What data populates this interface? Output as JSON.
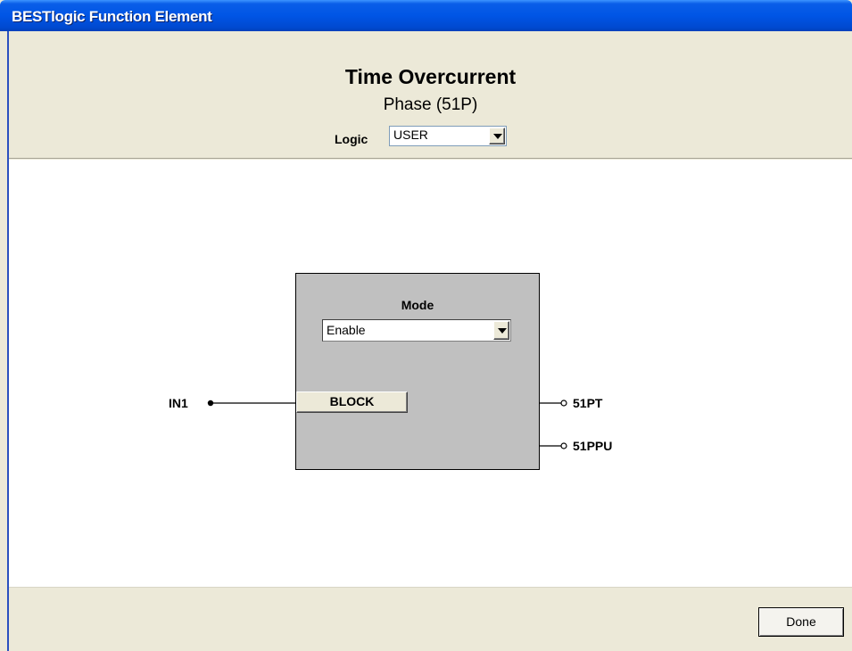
{
  "window": {
    "title": "BESTlogic Function Element"
  },
  "header": {
    "title": "Time Overcurrent",
    "subtitle": "Phase (51P)",
    "logic_label": "Logic",
    "logic_value": "USER"
  },
  "block": {
    "mode_label": "Mode",
    "mode_value": "Enable",
    "block_button_label": "BLOCK",
    "input_label": "IN1",
    "outputs": [
      "51PT",
      "51PPU"
    ]
  },
  "footer": {
    "done_label": "Done"
  },
  "icons": {
    "dropdown": "chevron-down-icon"
  },
  "colors": {
    "titlebar": "#0055e5",
    "panel": "#ece9d8",
    "block_fill": "#c0c0c0"
  }
}
